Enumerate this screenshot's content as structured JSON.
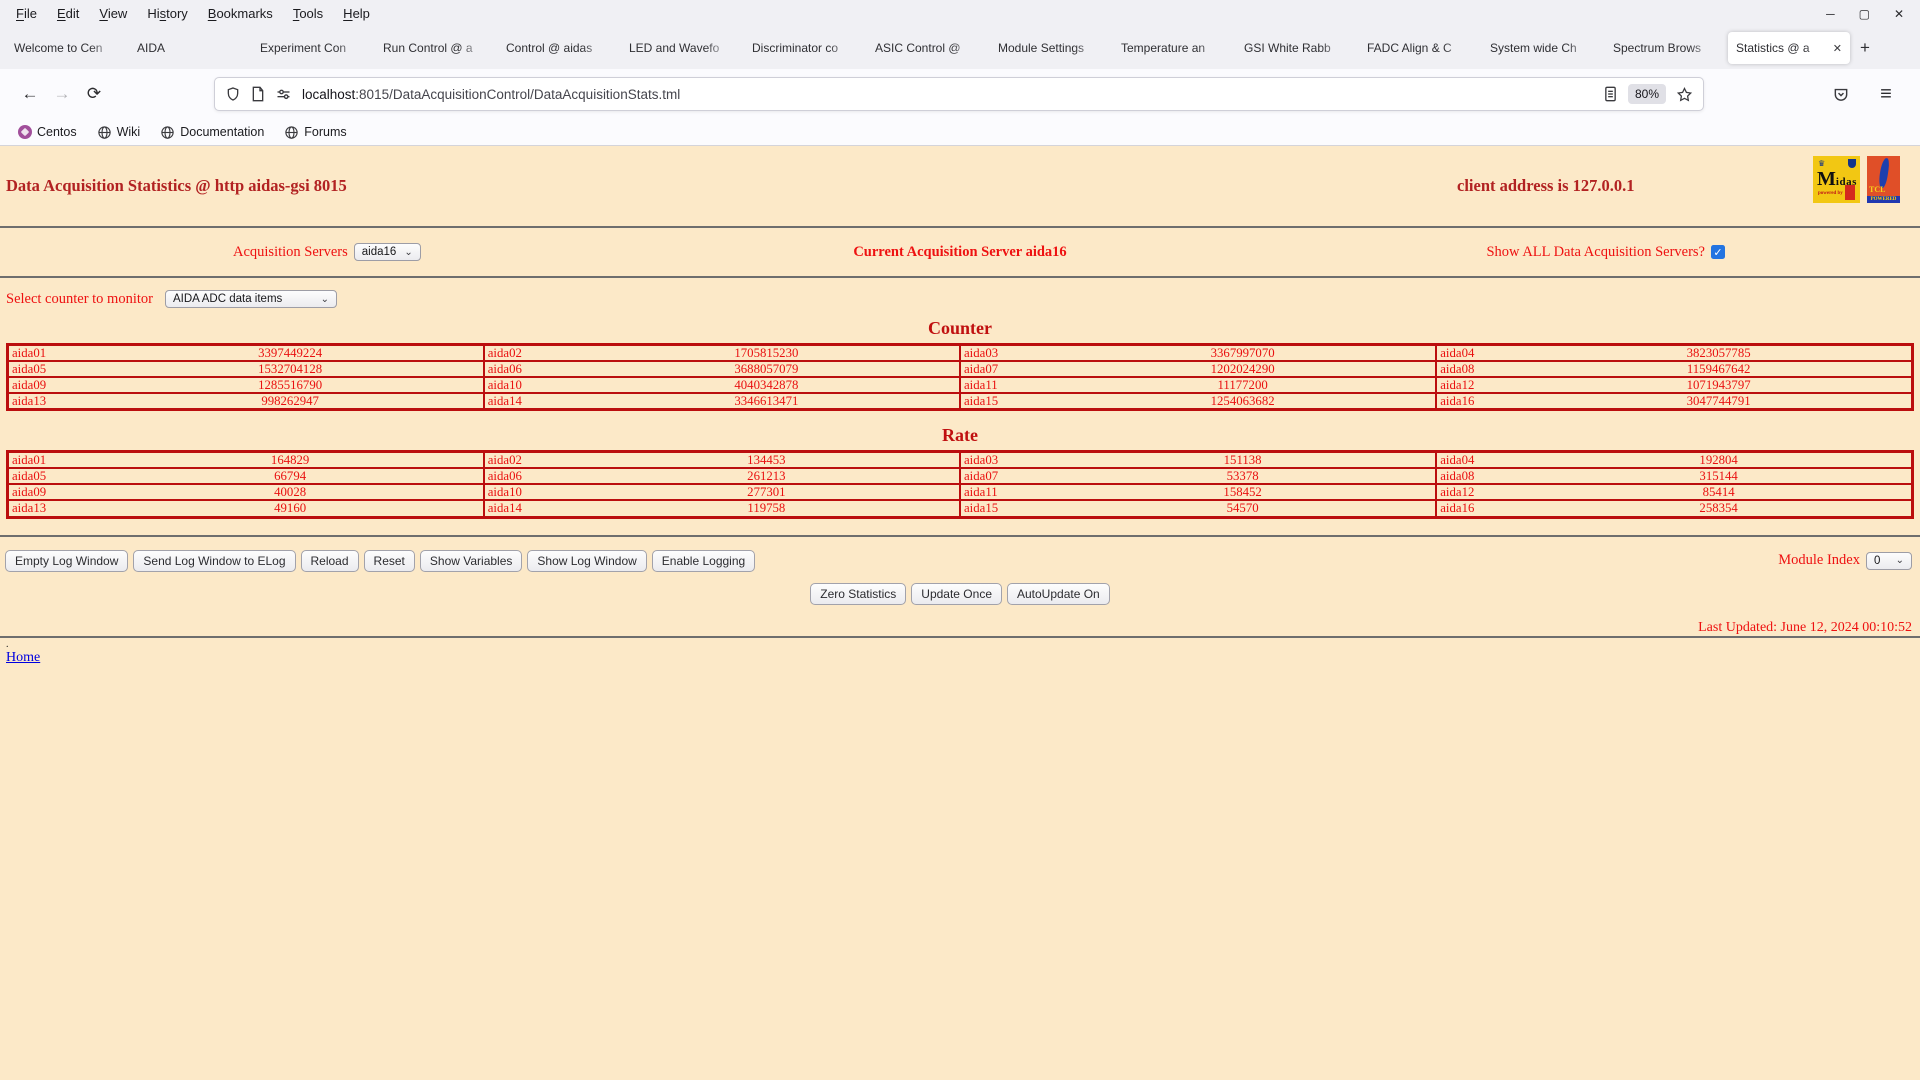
{
  "browser": {
    "menu": [
      {
        "label": "File",
        "accel": "F"
      },
      {
        "label": "Edit",
        "accel": "E"
      },
      {
        "label": "View",
        "accel": "V"
      },
      {
        "label": "History",
        "accel": "s"
      },
      {
        "label": "Bookmarks",
        "accel": "B"
      },
      {
        "label": "Tools",
        "accel": "T"
      },
      {
        "label": "Help",
        "accel": "H"
      }
    ],
    "tabs": [
      "Welcome to Cen",
      "AIDA",
      "Experiment Con",
      "Run Control @ a",
      "Control @ aidas",
      "LED and Wavefo",
      "Discriminator co",
      "ASIC Control @",
      "Module Settings",
      "Temperature an",
      "GSI White Rabb",
      "FADC Align & C",
      "System wide Ch",
      "Spectrum Brows",
      "Statistics @ a"
    ],
    "active_tab_index": 14,
    "url_host": "localhost",
    "url_rest": ":8015/DataAcquisitionControl/DataAcquisitionStats.tml",
    "zoom_level": "80%",
    "bookmarks": [
      "Centos",
      "Wiki",
      "Documentation",
      "Forums"
    ]
  },
  "icons": {
    "back": "←",
    "forward": "→",
    "reload": "⟳",
    "star": "☆",
    "menu": "≡",
    "new_tab": "+",
    "close_tab": "✕",
    "minimize": "─",
    "maximize": "▢",
    "close_window": "✕",
    "chevron": "⌄",
    "check": "✓"
  },
  "page": {
    "title": "Data Acquisition Statistics @ http aidas-gsi 8015",
    "client_address": "client address is 127.0.0.1",
    "acquisition_servers_label": "Acquisition Servers",
    "acquisition_server_selected": "aida16",
    "current_server_text": "Current Acquisition Server aida16",
    "show_all_label": "Show ALL Data Acquisition Servers?",
    "show_all_checked": true,
    "counter_select_label": "Select counter to monitor",
    "counter_select_value": "AIDA ADC data items",
    "counter_heading": "Counter",
    "rate_heading": "Rate",
    "counter_rows": [
      [
        [
          "aida01",
          "3397449224"
        ],
        [
          "aida02",
          "1705815230"
        ],
        [
          "aida03",
          "3367997070"
        ],
        [
          "aida04",
          "3823057785"
        ]
      ],
      [
        [
          "aida05",
          "1532704128"
        ],
        [
          "aida06",
          "3688057079"
        ],
        [
          "aida07",
          "1202024290"
        ],
        [
          "aida08",
          "1159467642"
        ]
      ],
      [
        [
          "aida09",
          "1285516790"
        ],
        [
          "aida10",
          "4040342878"
        ],
        [
          "aida11",
          "11177200"
        ],
        [
          "aida12",
          "1071943797"
        ]
      ],
      [
        [
          "aida13",
          "998262947"
        ],
        [
          "aida14",
          "3346613471"
        ],
        [
          "aida15",
          "1254063682"
        ],
        [
          "aida16",
          "3047744791"
        ]
      ]
    ],
    "rate_rows": [
      [
        [
          "aida01",
          "164829"
        ],
        [
          "aida02",
          "134453"
        ],
        [
          "aida03",
          "151138"
        ],
        [
          "aida04",
          "192804"
        ]
      ],
      [
        [
          "aida05",
          "66794"
        ],
        [
          "aida06",
          "261213"
        ],
        [
          "aida07",
          "53378"
        ],
        [
          "aida08",
          "315144"
        ]
      ],
      [
        [
          "aida09",
          "40028"
        ],
        [
          "aida10",
          "277301"
        ],
        [
          "aida11",
          "158452"
        ],
        [
          "aida12",
          "85414"
        ]
      ],
      [
        [
          "aida13",
          "49160"
        ],
        [
          "aida14",
          "119758"
        ],
        [
          "aida15",
          "54570"
        ],
        [
          "aida16",
          "258354"
        ]
      ]
    ],
    "log_buttons": [
      "Empty Log Window",
      "Send Log Window to ELog",
      "Reload",
      "Reset",
      "Show Variables",
      "Show Log Window",
      "Enable Logging"
    ],
    "module_index_label": "Module Index",
    "module_index_value": "0",
    "action_buttons": [
      "Zero Statistics",
      "Update Once",
      "AutoUpdate On"
    ],
    "last_updated": "Last Updated: June 12, 2024 00:10:52",
    "dot": ".",
    "home_link": "Home"
  },
  "logos": {
    "midas_text": "Midas",
    "midas_powered": "powered by",
    "tcl_text": "TCL",
    "tcl_powered": "POWERED"
  },
  "colors": {
    "page_bg": "#fce9c8",
    "table_border": "#bb0e0e",
    "label_red": "#ee1111",
    "title_red": "#b22222",
    "checkbox_blue": "#2374e1",
    "link_blue": "#0000e0"
  }
}
